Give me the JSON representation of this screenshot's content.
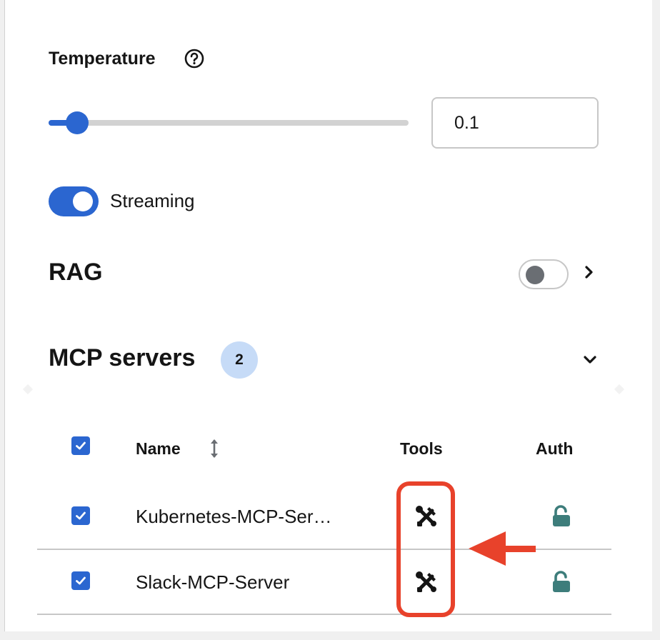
{
  "temperature": {
    "label": "Temperature",
    "help_icon": "help-circle-icon",
    "slider_value_fraction": 0.05,
    "input_value": "0.1"
  },
  "streaming": {
    "label": "Streaming",
    "enabled": true
  },
  "rag": {
    "title": "RAG",
    "enabled": false,
    "chevron_icon": "chevron-right-icon"
  },
  "mcp": {
    "title": "MCP servers",
    "count_badge": "2",
    "chevron_icon": "chevron-down-icon",
    "table": {
      "columns": [
        "Name",
        "Tools",
        "Auth"
      ],
      "rows": [
        {
          "name": "Kubernetes-MCP-Ser…",
          "selected": true,
          "tools_icon": "wrench-screwdriver-icon",
          "auth_icon": "unlocked-icon"
        },
        {
          "name": "Slack-MCP-Server",
          "selected": true,
          "tools_icon": "wrench-screwdriver-icon",
          "auth_icon": "unlocked-icon"
        }
      ]
    }
  },
  "colors": {
    "accent": "#2b66d0",
    "badge_bg": "#c6dbf7",
    "lock": "#3d7d7b",
    "annotation": "#e8422b"
  }
}
